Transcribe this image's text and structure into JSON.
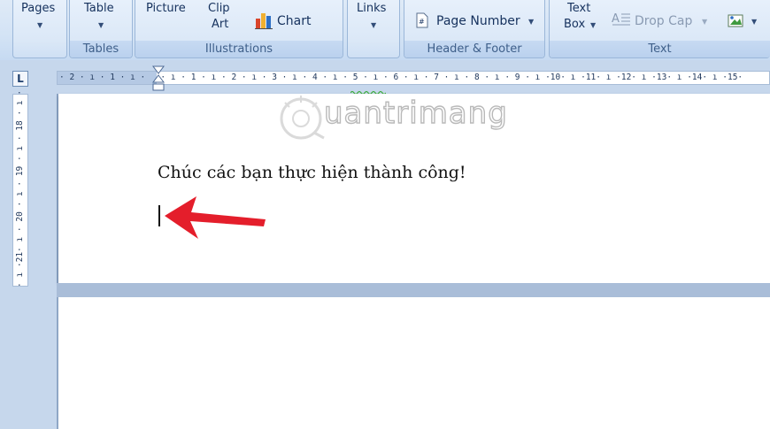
{
  "ribbon": {
    "pages_label": "Pages",
    "table_label": "Table",
    "tables_caption": "Tables",
    "picture_label": "Picture",
    "clipart_label_1": "Clip",
    "clipart_label_2": "Art",
    "chart_label": "Chart",
    "illustrations_caption": "Illustrations",
    "links_label": "Links",
    "page_number_label": "Page Number",
    "header_footer_caption": "Header & Footer",
    "textbox_label_1": "Text",
    "textbox_label_2": "Box",
    "dropcap_label": "Drop Cap",
    "text_caption": "Text",
    "colors": {
      "accent": "#15315d",
      "caption": "#3e5f8a"
    }
  },
  "ruler": {
    "tab_selector": "L",
    "horizontal": "· 2 · ı · 1 · ı ·   · ı · 1 · ı · 2 · ı · 3 · ı · 4 · ı · 5 · ı · 6 · ı · 7 · ı · 8 · ı · 9 · ı ·10· ı ·11· ı ·12· ı ·13· ı ·14· ı ·15·",
    "vertical": "· ı ·21· ı · 20 · ı · 19 · ı · 18 · ı ·"
  },
  "document": {
    "line1": "Chúc các bạn thực hiện thành công!",
    "watermark": "uantrimang"
  },
  "icons": {
    "chart": "chart-icon",
    "page_number": "page-number-icon",
    "drop_cap": "drop-cap-icon",
    "picture_insert": "insert-object-icon",
    "arrow": "red-arrow-annotation"
  }
}
